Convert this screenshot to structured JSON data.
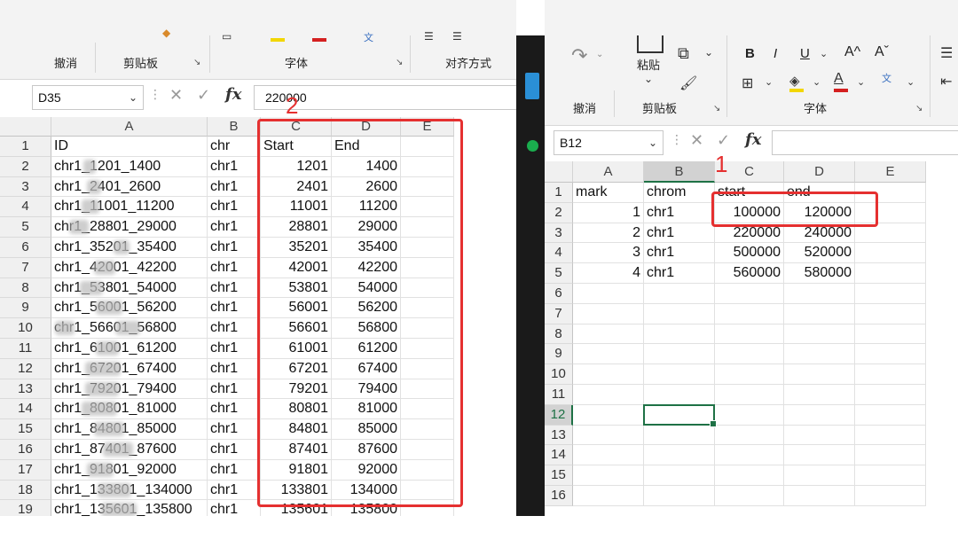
{
  "left": {
    "ribbon_groups": [
      "撤消",
      "剪贴板",
      "字体",
      "对齐方式"
    ],
    "name_box": "D35",
    "formula_value": "220000",
    "columns": [
      "A",
      "B",
      "C",
      "D",
      "E"
    ],
    "rows": [
      {
        "n": "1",
        "a": "ID",
        "b": "chr",
        "c": "Start",
        "d": "End"
      },
      {
        "n": "2",
        "a": "chr1_1201_1400",
        "b": "chr1",
        "c": "1201",
        "d": "1400"
      },
      {
        "n": "3",
        "a": "chr1_2401_2600",
        "b": "chr1",
        "c": "2401",
        "d": "2600"
      },
      {
        "n": "4",
        "a": "chr1_11001_11200",
        "b": "chr1",
        "c": "11001",
        "d": "11200"
      },
      {
        "n": "5",
        "a": "chr1_28801_29000",
        "b": "chr1",
        "c": "28801",
        "d": "29000"
      },
      {
        "n": "6",
        "a": "chr1_35201_35400",
        "b": "chr1",
        "c": "35201",
        "d": "35400"
      },
      {
        "n": "7",
        "a": "chr1_42001_42200",
        "b": "chr1",
        "c": "42001",
        "d": "42200"
      },
      {
        "n": "8",
        "a": "chr1_53801_54000",
        "b": "chr1",
        "c": "53801",
        "d": "54000"
      },
      {
        "n": "9",
        "a": "chr1_56001_56200",
        "b": "chr1",
        "c": "56001",
        "d": "56200"
      },
      {
        "n": "10",
        "a": "chr1_56601_56800",
        "b": "chr1",
        "c": "56601",
        "d": "56800"
      },
      {
        "n": "11",
        "a": "chr1_61001_61200",
        "b": "chr1",
        "c": "61001",
        "d": "61200"
      },
      {
        "n": "12",
        "a": "chr1_67201_67400",
        "b": "chr1",
        "c": "67201",
        "d": "67400"
      },
      {
        "n": "13",
        "a": "chr1_79201_79400",
        "b": "chr1",
        "c": "79201",
        "d": "79400"
      },
      {
        "n": "14",
        "a": "chr1_80801_81000",
        "b": "chr1",
        "c": "80801",
        "d": "81000"
      },
      {
        "n": "15",
        "a": "chr1_84801_85000",
        "b": "chr1",
        "c": "84801",
        "d": "85000"
      },
      {
        "n": "16",
        "a": "chr1_87401_87600",
        "b": "chr1",
        "c": "87401",
        "d": "87600"
      },
      {
        "n": "17",
        "a": "chr1_91801_92000",
        "b": "chr1",
        "c": "91801",
        "d": "92000"
      },
      {
        "n": "18",
        "a": "chr1_133801_134000",
        "b": "chr1",
        "c": "133801",
        "d": "134000"
      },
      {
        "n": "19",
        "a": "chr1_135601_135800",
        "b": "chr1",
        "c": "135601",
        "d": "135800"
      }
    ],
    "annotation_label": "2"
  },
  "right": {
    "ribbon_groups": [
      "撤消",
      "剪贴板",
      "字体"
    ],
    "paste_label": "粘贴",
    "name_box": "B12",
    "formula_value": "",
    "columns": [
      "A",
      "B",
      "C",
      "D",
      "E"
    ],
    "rows": [
      {
        "n": "1",
        "a": "mark",
        "b": "chrom",
        "c": "start",
        "d": "end"
      },
      {
        "n": "2",
        "a": "1",
        "b": "chr1",
        "c": "100000",
        "d": "120000"
      },
      {
        "n": "3",
        "a": "2",
        "b": "chr1",
        "c": "220000",
        "d": "240000"
      },
      {
        "n": "4",
        "a": "3",
        "b": "chr1",
        "c": "500000",
        "d": "520000"
      },
      {
        "n": "5",
        "a": "4",
        "b": "chr1",
        "c": "560000",
        "d": "580000"
      },
      {
        "n": "6"
      },
      {
        "n": "7"
      },
      {
        "n": "8"
      },
      {
        "n": "9"
      },
      {
        "n": "10"
      },
      {
        "n": "11"
      },
      {
        "n": "12"
      },
      {
        "n": "13"
      },
      {
        "n": "14"
      },
      {
        "n": "15"
      },
      {
        "n": "16"
      }
    ],
    "annotation_label": "1",
    "font_buttons": [
      "B",
      "I",
      "U",
      "A^",
      "Aˇ"
    ]
  },
  "colors": {
    "annotation": "#e53030",
    "selection": "#1e7145"
  }
}
